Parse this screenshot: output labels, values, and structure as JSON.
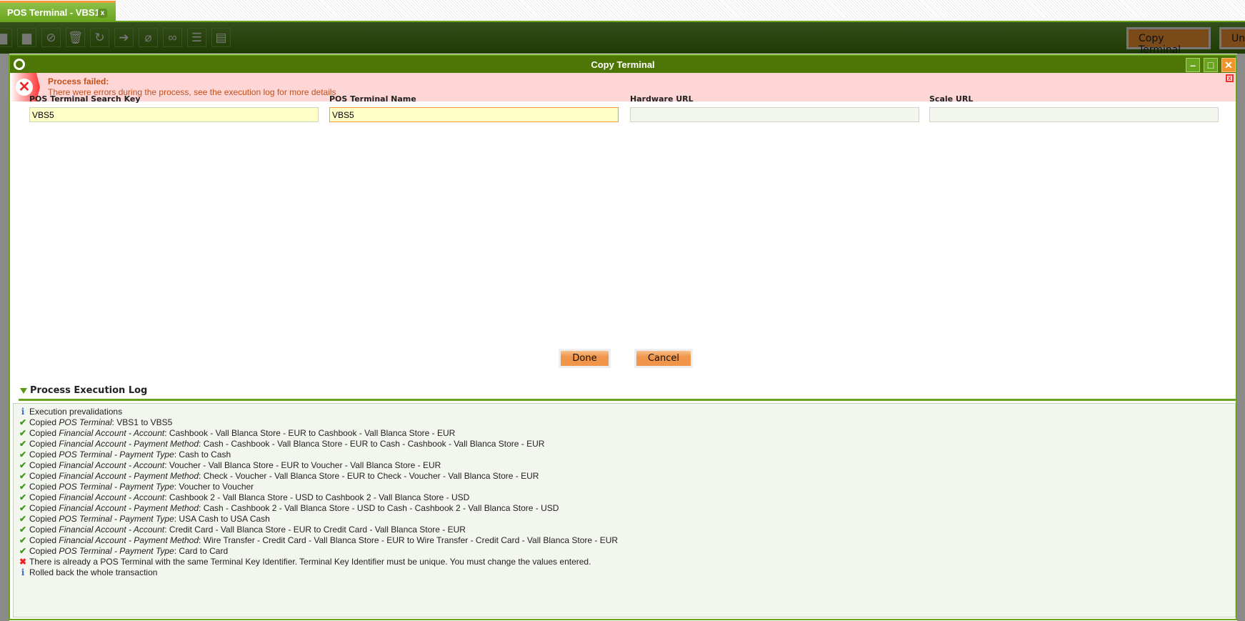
{
  "tab": {
    "label": "POS Terminal - VBS1",
    "close": "x"
  },
  "toolbar": {
    "copy_terminal": "Copy Terminal",
    "unlink": "Unl"
  },
  "dialog": {
    "title": "Copy Terminal",
    "error": {
      "title": "Process failed:",
      "message": "There were errors during the process, see the execution log for more details"
    },
    "fields": [
      {
        "label": "POS Terminal Search Key",
        "value": "VBS5"
      },
      {
        "label": "POS Terminal Name",
        "value": "VBS5"
      },
      {
        "label": "Hardware URL",
        "value": ""
      },
      {
        "label": "Scale URL",
        "value": ""
      }
    ],
    "buttons": {
      "done": "Done",
      "cancel": "Cancel"
    },
    "log": {
      "title": "Process Execution Log",
      "lines": [
        {
          "type": "info",
          "pre": "Execution prevalidations",
          "em": "",
          "post": ""
        },
        {
          "type": "ok",
          "pre": "Copied ",
          "em": "POS Terminal",
          "post": ": VBS1 to VBS5"
        },
        {
          "type": "ok",
          "pre": "Copied ",
          "em": "Financial Account - Account",
          "post": ": Cashbook - Vall Blanca Store - EUR to Cashbook - Vall Blanca Store - EUR"
        },
        {
          "type": "ok",
          "pre": "Copied ",
          "em": "Financial Account - Payment Method",
          "post": ": Cash - Cashbook - Vall Blanca Store - EUR to Cash - Cashbook - Vall Blanca Store - EUR"
        },
        {
          "type": "ok",
          "pre": "Copied ",
          "em": "POS Terminal - Payment Type",
          "post": ": Cash to Cash"
        },
        {
          "type": "ok",
          "pre": "Copied ",
          "em": "Financial Account - Account",
          "post": ": Voucher - Vall Blanca Store - EUR to Voucher - Vall Blanca Store - EUR"
        },
        {
          "type": "ok",
          "pre": "Copied ",
          "em": "Financial Account - Payment Method",
          "post": ": Check - Voucher - Vall Blanca Store - EUR to Check - Voucher - Vall Blanca Store - EUR"
        },
        {
          "type": "ok",
          "pre": "Copied ",
          "em": "POS Terminal - Payment Type",
          "post": ": Voucher to Voucher"
        },
        {
          "type": "ok",
          "pre": "Copied ",
          "em": "Financial Account - Account",
          "post": ": Cashbook 2 - Vall Blanca Store - USD to Cashbook 2 - Vall Blanca Store - USD"
        },
        {
          "type": "ok",
          "pre": "Copied ",
          "em": "Financial Account - Payment Method",
          "post": ": Cash - Cashbook 2 - Vall Blanca Store - USD to Cash - Cashbook 2 - Vall Blanca Store - USD"
        },
        {
          "type": "ok",
          "pre": "Copied ",
          "em": "POS Terminal - Payment Type",
          "post": ": USA Cash to USA Cash"
        },
        {
          "type": "ok",
          "pre": "Copied ",
          "em": "Financial Account - Account",
          "post": ": Credit Card - Vall Blanca Store - EUR to Credit Card - Vall Blanca Store - EUR"
        },
        {
          "type": "ok",
          "pre": "Copied ",
          "em": "Financial Account - Payment Method",
          "post": ": Wire Transfer - Credit Card - Vall Blanca Store - EUR to Wire Transfer - Credit Card - Vall Blanca Store - EUR"
        },
        {
          "type": "ok",
          "pre": "Copied ",
          "em": "POS Terminal - Payment Type",
          "post": ": Card to Card"
        },
        {
          "type": "err",
          "pre": "There is already a POS Terminal with the same Terminal Key Identifier. Terminal Key Identifier must be unique. You must change the values entered.",
          "em": "",
          "post": ""
        },
        {
          "type": "info",
          "pre": "Rolled back the whole transaction",
          "em": "",
          "post": ""
        }
      ]
    }
  }
}
